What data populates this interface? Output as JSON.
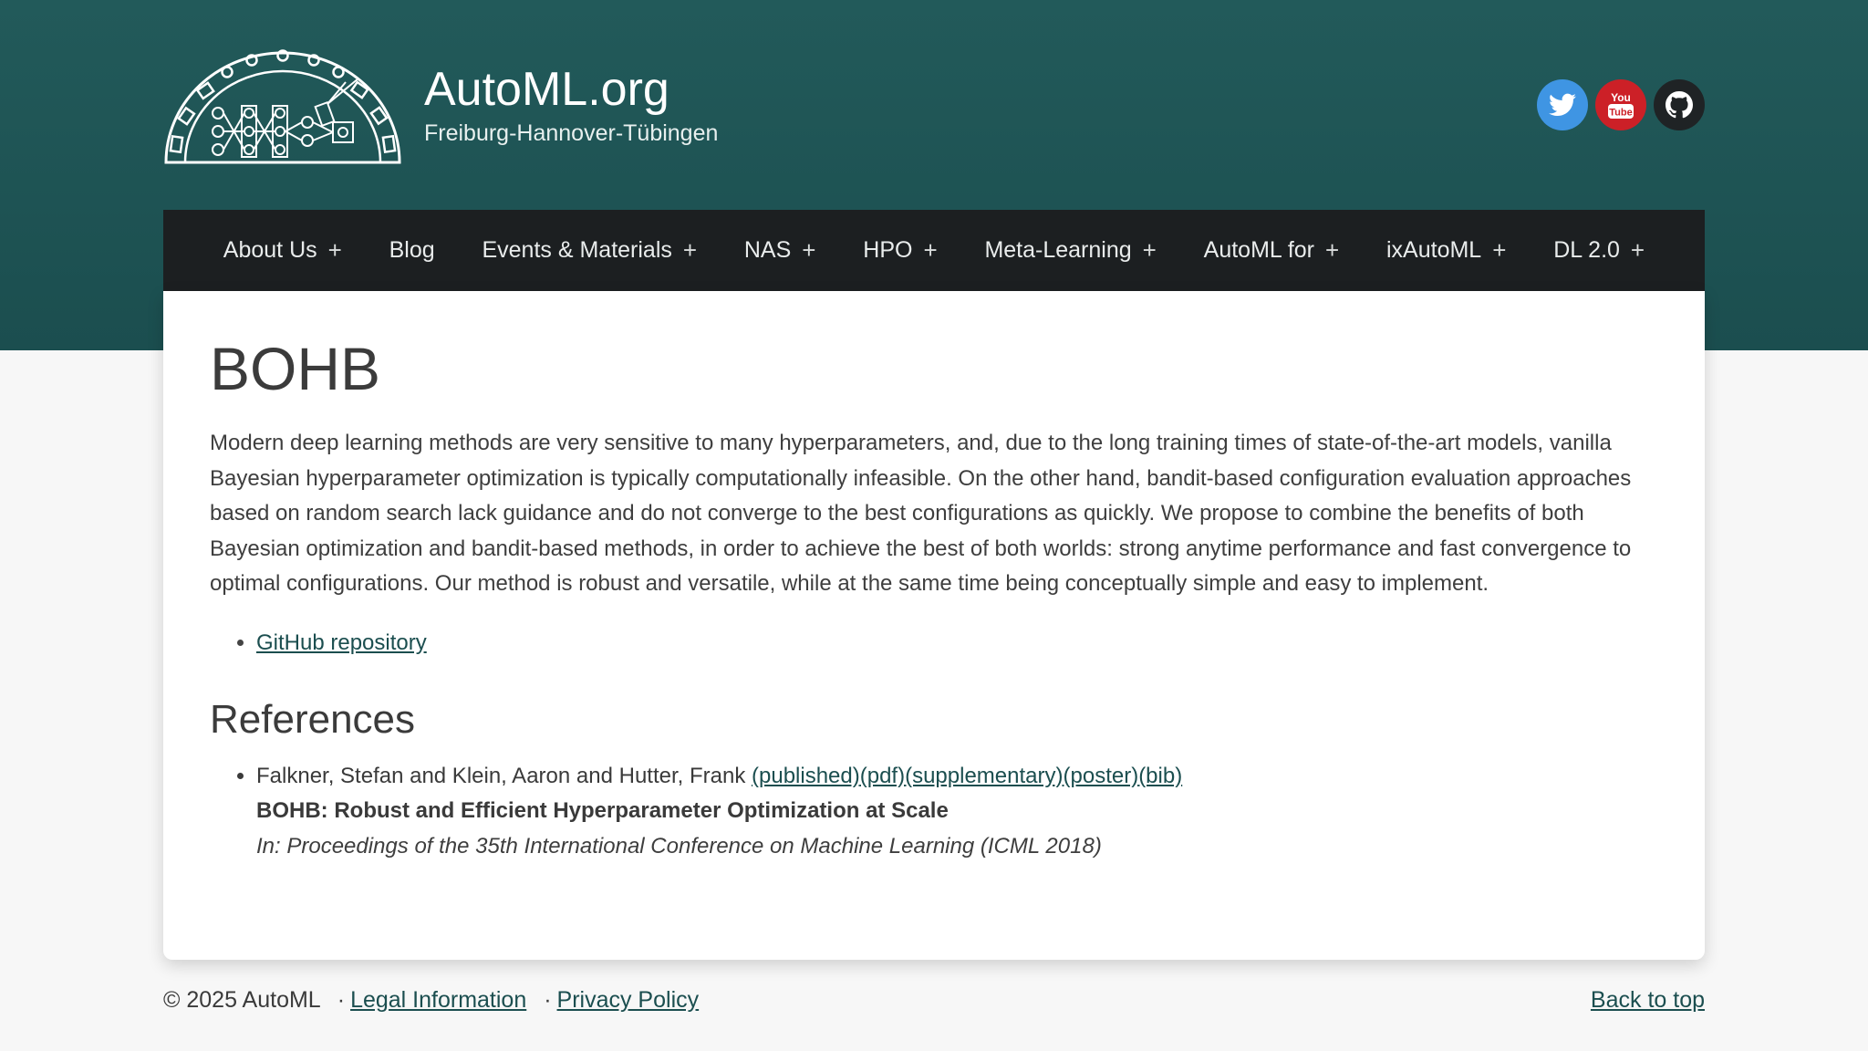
{
  "header": {
    "site_title": "AutoML.org",
    "site_subtitle": "Freiburg-Hannover-Tübingen",
    "social": [
      {
        "name": "twitter",
        "icon": "twitter-bird-icon",
        "color": "#3f95e3"
      },
      {
        "name": "youtube",
        "icon": "youtube-icon",
        "color": "#cc2027",
        "text_top": "You",
        "text_bottom": "Tube"
      },
      {
        "name": "github",
        "icon": "github-octocat-icon",
        "color": "#1f2325"
      }
    ]
  },
  "nav": {
    "items": [
      {
        "label": "About Us",
        "expandable": "+"
      },
      {
        "label": "Blog"
      },
      {
        "label": "Events & Materials",
        "expandable": "+"
      },
      {
        "label": "NAS",
        "expandable": "+"
      },
      {
        "label": "HPO",
        "expandable": "+"
      },
      {
        "label": "Meta-Learning",
        "expandable": "+"
      },
      {
        "label": "AutoML for",
        "expandable": "+"
      },
      {
        "label": "ixAutoML",
        "expandable": "+"
      },
      {
        "label": "DL 2.0",
        "expandable": "+"
      }
    ]
  },
  "main": {
    "title": "BOHB",
    "abstract": "Modern deep learning methods are very sensitive to many hyperparameters, and, due to the long training times of state-of-the-art models, vanilla Bayesian hyperparameter optimization is typically computationally infeasible. On the other hand, bandit-based configuration evaluation approaches based on random search lack guidance and do not converge to the best configurations as quickly. We propose to combine the benefits of both Bayesian optimization and bandit-based methods, in order to achieve the best of both worlds: strong anytime performance and fast convergence to optimal configurations. Our method is robust and versatile, while at the same time being conceptually simple and easy to implement.",
    "links": [
      {
        "label": "GitHub repository"
      }
    ],
    "references_heading": "References",
    "references": [
      {
        "authors": "Falkner, Stefan and Klein, Aaron and Hutter, Frank",
        "links": [
          "(published)",
          "(pdf)",
          "(supplementary)",
          "(poster)",
          "(bib)"
        ],
        "title": "BOHB: Robust and Efficient Hyperparameter Optimization at Scale",
        "venue": "In: Proceedings of the 35th International Conference on Machine Learning (ICML 2018)"
      }
    ]
  },
  "footer": {
    "copyright": "© 2025 AutoML",
    "separator": "·",
    "legal": "Legal Information",
    "privacy": "Privacy Policy",
    "back_to_top": "Back to top"
  },
  "colors": {
    "header_bg": "#225a5a",
    "nav_bg": "#1c1f21",
    "link": "#1b4e4f",
    "page_bg": "#f7f7f7"
  }
}
